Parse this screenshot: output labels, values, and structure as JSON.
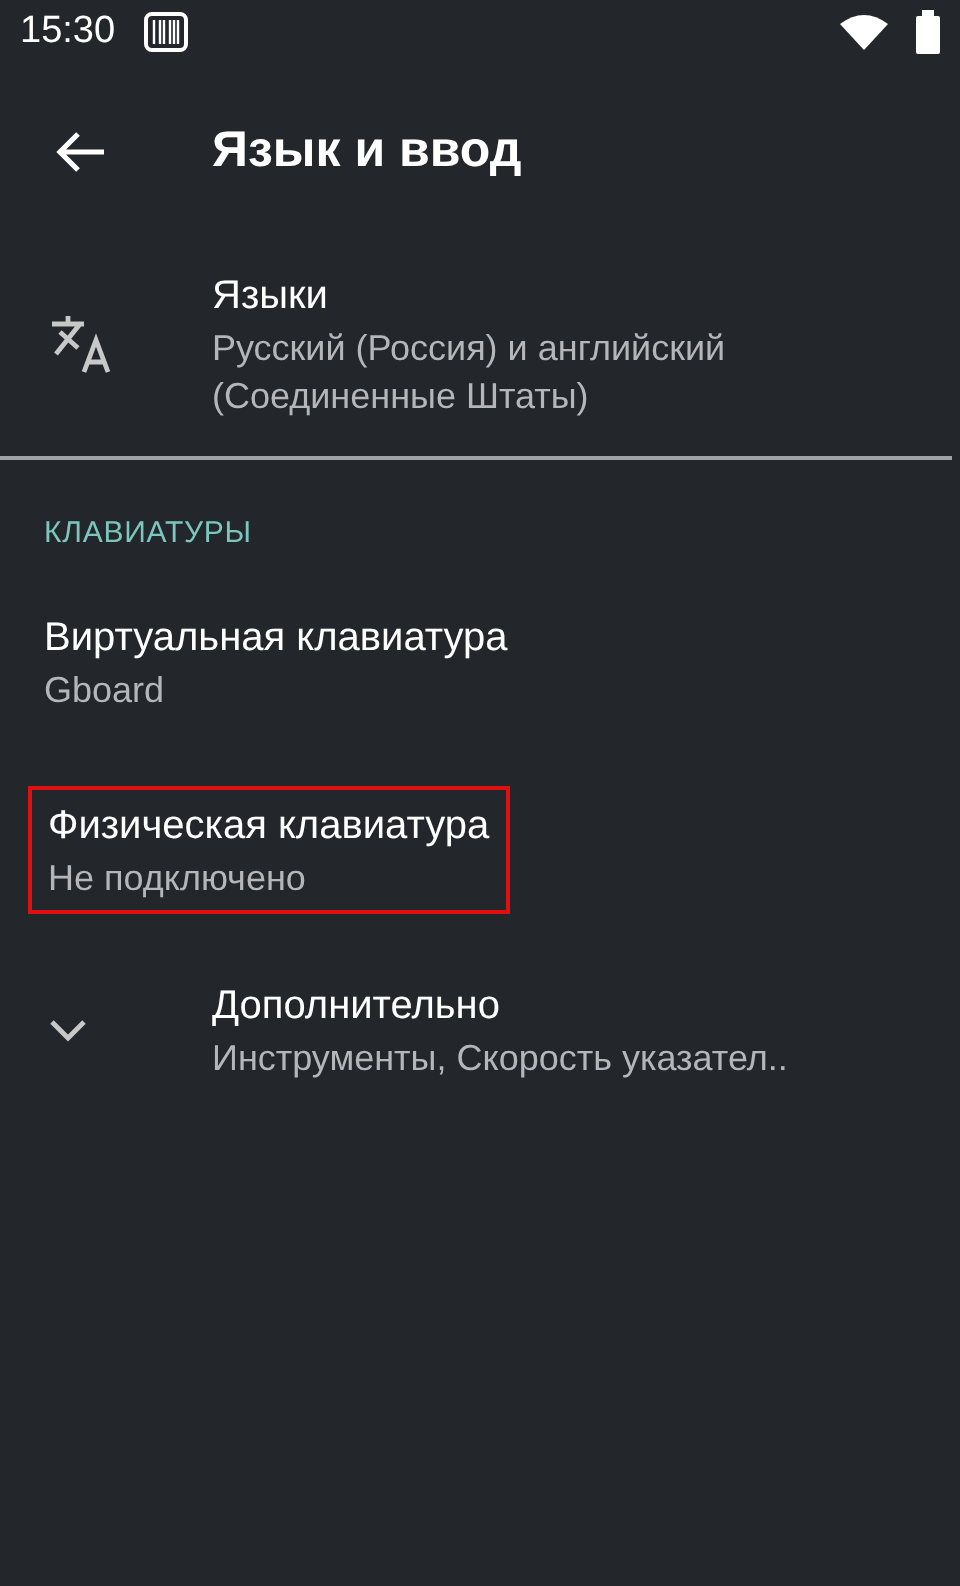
{
  "status_bar": {
    "time": "15:30"
  },
  "toolbar": {
    "title": "Язык и ввод"
  },
  "sections": [
    {
      "items": [
        {
          "kind": "icon",
          "title": "Языки",
          "summary": "Русский (Россия) и английский (Соединенные Штаты)",
          "highlighted": false
        }
      ]
    },
    {
      "header": "КЛАВИАТУРЫ",
      "items": [
        {
          "kind": "plain",
          "title": "Виртуальная клавиатура",
          "summary": "Gboard",
          "highlighted": false
        },
        {
          "kind": "plain",
          "title": "Физическая клавиатура",
          "summary": "Не подключено",
          "highlighted": true
        },
        {
          "kind": "expander",
          "title": "Дополнительно",
          "summary": "Инструменты, Скорость указател..",
          "highlighted": false
        }
      ]
    }
  ]
}
